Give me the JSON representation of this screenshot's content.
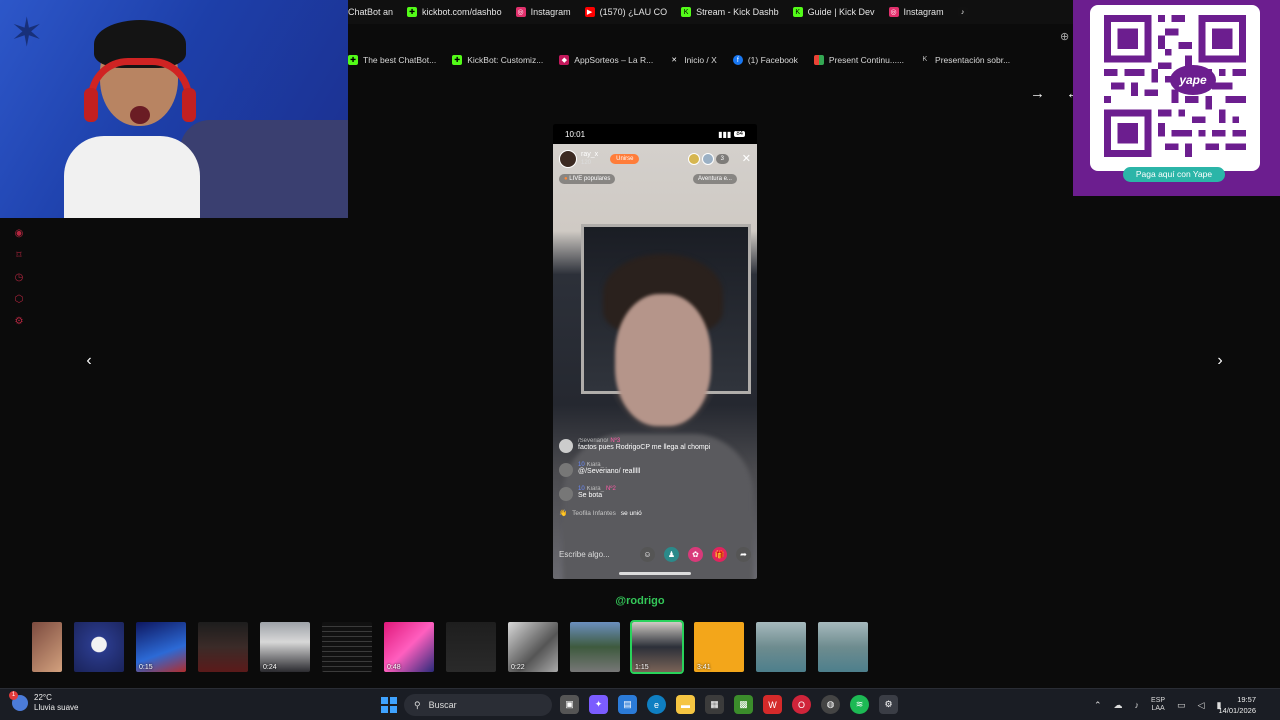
{
  "browser": {
    "tabs": [
      {
        "label": "ChatBot an",
        "icon": "none",
        "color": "#101010"
      },
      {
        "label": "kickbot.com/dashbo",
        "icon": "kickbot-icon",
        "color": "#53fc18"
      },
      {
        "label": "Instagram",
        "icon": "instagram-icon",
        "color": "#e1306c"
      },
      {
        "label": "(1570) ¿LAU CO",
        "icon": "youtube-icon",
        "color": "#ff0000"
      },
      {
        "label": "Stream - Kick Dashb",
        "icon": "kick-icon",
        "color": "#53fc18"
      },
      {
        "label": "Guide | Kick Dev",
        "icon": "kick-icon",
        "color": "#53fc18"
      },
      {
        "label": "Instagram",
        "icon": "instagram-icon",
        "color": "#e1306c"
      }
    ],
    "bookmarks": [
      {
        "label": "The best ChatBot...",
        "icon": "kickbot-icon",
        "color": "#53fc18"
      },
      {
        "label": "KickBot: Customiz...",
        "icon": "kickbot-icon",
        "color": "#53fc18"
      },
      {
        "label": "AppSorteos – La R...",
        "icon": "appsorteos-icon",
        "color": "#c2185b"
      },
      {
        "label": "Inicio / X",
        "icon": "x-icon",
        "color": "#ffffff"
      },
      {
        "label": "(1) Facebook",
        "icon": "facebook-icon",
        "color": "#1877f2"
      },
      {
        "label": "Present Continu......",
        "icon": "present-icon",
        "color": "#f4b400"
      },
      {
        "label": "Presentación sobr...",
        "icon": "presentation-icon",
        "color": "#999999"
      }
    ]
  },
  "qr": {
    "brand": "yape",
    "label": "Paga aquí con Yape",
    "panel_color": "#6c1e8f",
    "label_color": "#2bb5a8"
  },
  "phone": {
    "status_time": "10:01",
    "battery": "84",
    "host_name": "ray_x",
    "host_likes": "120",
    "join_label": "Unirse",
    "viewer_count": "3",
    "popular_label": "LIVE populares",
    "adventure_label": "Aventura e...",
    "chat": [
      {
        "user": "/Severiano/",
        "level": "",
        "badge": "Nº3",
        "text": "factos pues RodrigoCP me llega al chompi"
      },
      {
        "user": "Kiara_",
        "level": "10",
        "badge": "",
        "text": "@/Severiano/ realllll"
      },
      {
        "user": "Kiara_",
        "level": "10",
        "badge": "Nº2",
        "text": "Se bota"
      }
    ],
    "joined_user": "Teofila Infantes",
    "joined_text": "se unió",
    "input_placeholder": "Escribe algo..."
  },
  "handle": "@rodrigo",
  "thumbnails": [
    {
      "dur": ""
    },
    {
      "dur": ""
    },
    {
      "dur": "0:15"
    },
    {
      "dur": ""
    },
    {
      "dur": "0:24"
    },
    {
      "dur": ""
    },
    {
      "dur": "0:48"
    },
    {
      "dur": ""
    },
    {
      "dur": "0:22"
    },
    {
      "dur": ""
    },
    {
      "dur": "1:15"
    },
    {
      "dur": "3:41"
    },
    {
      "dur": ""
    },
    {
      "dur": ""
    }
  ],
  "taskbar": {
    "temp": "22°C",
    "weather": "Lluvia suave",
    "weather_badge": "1",
    "search": "Buscar",
    "lang1": "ESP",
    "lang2": "LAA",
    "time": "19:57",
    "date": "14/01/2026"
  }
}
